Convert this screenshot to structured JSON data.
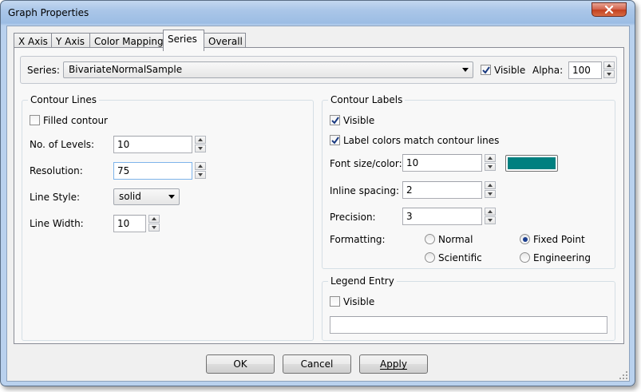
{
  "window": {
    "title": "Graph Properties"
  },
  "tabs": [
    {
      "label": "X Axis"
    },
    {
      "label": "Y Axis"
    },
    {
      "label": "Color Mapping"
    },
    {
      "label": "Series",
      "active": true
    },
    {
      "label": "Overall"
    }
  ],
  "series": {
    "label": "Series:",
    "selected": "BivariateNormalSample",
    "visible_label": "Visible",
    "visible_checked": true,
    "alpha_label": "Alpha:",
    "alpha_value": "100"
  },
  "contour_lines": {
    "title": "Contour Lines",
    "filled_label": "Filled contour",
    "filled_checked": false,
    "levels_label": "No. of Levels:",
    "levels_value": "10",
    "resolution_label": "Resolution:",
    "resolution_value": "75",
    "line_style_label": "Line Style:",
    "line_style_value": "solid",
    "line_width_label": "Line Width:",
    "line_width_value": "10"
  },
  "contour_labels": {
    "title": "Contour Labels",
    "visible_label": "Visible",
    "visible_checked": true,
    "match_label": "Label colors match contour lines",
    "match_checked": true,
    "font_label": "Font size/color:",
    "font_value": "10",
    "font_color": "#008080",
    "inline_label": "Inline spacing:",
    "inline_value": "2",
    "precision_label": "Precision:",
    "precision_value": "3",
    "formatting_label": "Formatting:",
    "formats": {
      "normal": "Normal",
      "fixed": "Fixed Point",
      "scientific": "Scientific",
      "engineering": "Engineering"
    },
    "selected_format": "Fixed Point"
  },
  "legend": {
    "title": "Legend Entry",
    "visible_label": "Visible",
    "visible_checked": false,
    "text_value": ""
  },
  "buttons": {
    "ok": "OK",
    "cancel": "Cancel",
    "apply": "Apply"
  }
}
